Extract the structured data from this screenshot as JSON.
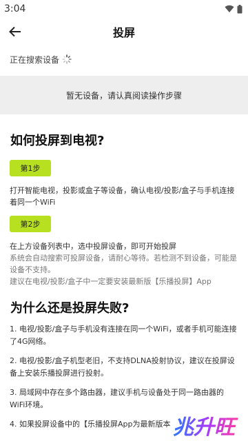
{
  "status": {
    "time": "3:04"
  },
  "header": {
    "title": "投屏"
  },
  "search": {
    "status_text": "正在搜索设备"
  },
  "empty": {
    "text": "暂无设备，请认真阅读操作步骤"
  },
  "how": {
    "title": "如何投屏到电视?",
    "step1_label": "第1步",
    "step1_text": "打开智能电视，投影或盒子等设备，确认电视/投影/盒子与手机连接着同一个WiFi",
    "step2_label": "第2步",
    "step2_text_a": "在上方设备列表中，选中投屏设备，即可开始投屏",
    "step2_text_b": "系统会自动搜索可投屏设备，请耐心等待。若检测不到设备，可能是设备不支持。",
    "step2_text_c": "建议在电视/投影/盒子中一定要安装最新版【乐播投屏】App"
  },
  "why": {
    "title": "为什么还是投屏失败?",
    "items": [
      "1. 电视/投影/盒子与手机没有连接在同一个WiFi，或者手机可能连接了4G网络。",
      "2. 电视/投影/盒子机型老旧，不支持DLNA投射协议，建议在投屏设备上安装乐播投屏进行投射。",
      "3. 局域网中存在多个路由器，建议手机与设备处于同一路由器的WiFi环境。",
      "4. 如果投屏设备中的【乐播投屏App为最新版本"
    ]
  },
  "watermark": {
    "text": "兆升旺"
  },
  "colors": {
    "accent": "#b7e021",
    "empty_bg": "#eeeeee"
  }
}
